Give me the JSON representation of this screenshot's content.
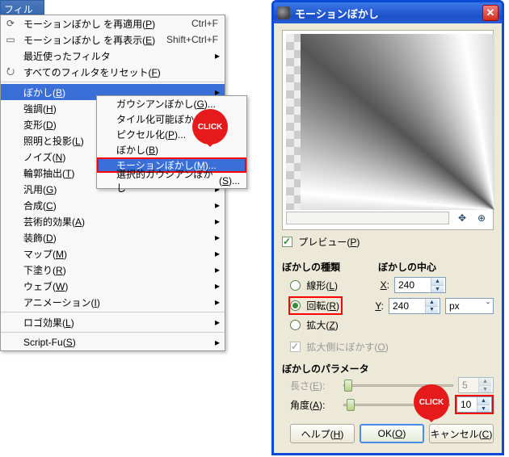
{
  "menu_title": {
    "text": "フィルタ",
    "accel": "R"
  },
  "menu": {
    "reapply": {
      "text": "モーションぼかし を再適用",
      "accel": "P",
      "shortcut": "Ctrl+F"
    },
    "reshow": {
      "text": "モーションぼかし を再表示",
      "accel": "E",
      "shortcut": "Shift+Ctrl+F"
    },
    "recent": {
      "text": "最近使ったフィルタ"
    },
    "reset": {
      "text": "すべてのフィルタをリセット",
      "accel": "F"
    },
    "blur": {
      "text": "ぼかし",
      "accel": "B"
    },
    "enhance": {
      "text": "強調",
      "accel": "H"
    },
    "distort": {
      "text": "変形",
      "accel": "D"
    },
    "light": {
      "text": "照明と投影",
      "accel": "L"
    },
    "noise": {
      "text": "ノイズ",
      "accel": "N"
    },
    "edge": {
      "text": "輪郭抽出",
      "accel": "T"
    },
    "generic": {
      "text": "汎用",
      "accel": "G"
    },
    "combine": {
      "text": "合成",
      "accel": "C"
    },
    "art": {
      "text": "芸術的効果",
      "accel": "A"
    },
    "decor": {
      "text": "装飾",
      "accel": "D"
    },
    "map": {
      "text": "マップ",
      "accel": "M"
    },
    "underpaint": {
      "text": "下塗り",
      "accel": "R"
    },
    "web": {
      "text": "ウェブ",
      "accel": "W"
    },
    "anim": {
      "text": "アニメーション",
      "accel": "I"
    },
    "logo": {
      "text": "ロゴ効果",
      "accel": "L"
    },
    "scriptfu": {
      "text": "Script-Fu",
      "accel": "S"
    }
  },
  "submenu": {
    "gauss": {
      "text": "ガウシアンぼかし",
      "accel": "G"
    },
    "tile": {
      "text": "タイル化可能ぼかし",
      "accel": "T"
    },
    "pixelize": {
      "text": "ピクセル化",
      "accel": "P"
    },
    "blur": {
      "text": "ぼかし",
      "accel": "B"
    },
    "motion": {
      "text": "モーションぼかし",
      "accel": "M"
    },
    "selgauss": {
      "text": "選択的ガウシアンぼかし",
      "accel": "S"
    }
  },
  "bubble": "CLICK",
  "dialog": {
    "title": "モーションぼかし",
    "preview_chk": {
      "text": "プレビュー",
      "accel": "P"
    },
    "type_group": "ぼかしの種類",
    "center_group": "ぼかしの中心",
    "type_linear": {
      "text": "線形",
      "accel": "L"
    },
    "type_rot": {
      "text": "回転",
      "accel": "R"
    },
    "type_zoom": {
      "text": "拡大",
      "accel": "Z"
    },
    "center_x": {
      "label": "X",
      "accel": "X",
      "value": "240"
    },
    "center_y": {
      "label": "Y",
      "accel": "Y",
      "value": "240"
    },
    "unit": "px",
    "blur_outside": {
      "text": "拡大側にぼかす",
      "accel": "O"
    },
    "param_group": "ぼかしのパラメータ",
    "length": {
      "label": "長さ",
      "accel": "E",
      "value": "5"
    },
    "angle": {
      "label": "角度",
      "accel": "A",
      "value": "10"
    },
    "help_btn": {
      "text": "ヘルプ",
      "accel": "H"
    },
    "ok_btn": {
      "text": "OK",
      "accel": "O"
    },
    "cancel_btn": {
      "text": "キャンセル",
      "accel": "C"
    }
  }
}
